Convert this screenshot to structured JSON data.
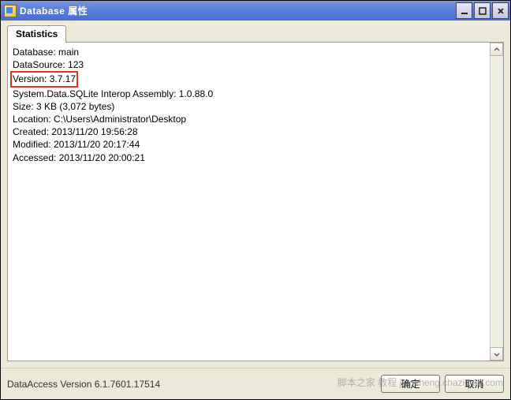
{
  "window": {
    "title": "Database 属性"
  },
  "tabs": {
    "statistics_label": "Statistics"
  },
  "info": {
    "database": "Database: main",
    "datasource": "DataSource: 123",
    "version": "Version: 3.7.17",
    "assembly": "System.Data.SQLite Interop Assembly: 1.0.88.0",
    "size": "Size: 3 KB (3,072 bytes)",
    "location": "Location: C:\\Users\\Administrator\\Desktop",
    "created": "Created: 2013/11/20 19:56:28",
    "modified": "Modified: 2013/11/20 20:17:44",
    "accessed": "Accessed: 2013/11/20 20:00:21"
  },
  "footer": {
    "version_text": "DataAccess Version 6.1.7601.17514",
    "ok_label": "确定",
    "cancel_label": "取消"
  },
  "watermark": "脚本之家 教程 jiaocheng.chazidian.com"
}
